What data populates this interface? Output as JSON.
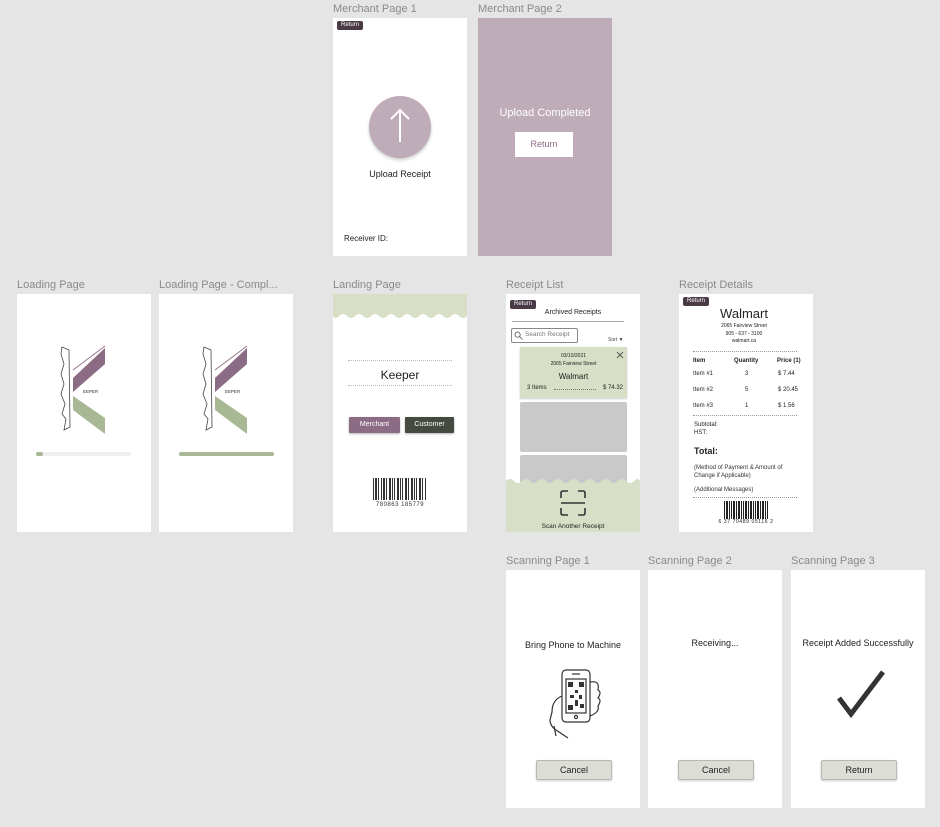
{
  "frames": {
    "merchant1": {
      "label": "Merchant Page 1",
      "return_label": "Return",
      "upload_label": "Upload Receipt",
      "receiver_label": "Receiver ID:"
    },
    "merchant2": {
      "label": "Merchant Page 2",
      "status": "Upload Completed",
      "return_label": "Return"
    },
    "loading": {
      "label": "Loading Page",
      "logo_text": "EEPER",
      "progress": 0.07
    },
    "loading_complete": {
      "label": "Loading Page - Compl...",
      "logo_text": "EEPER",
      "progress": 1.0
    },
    "landing": {
      "label": "Landing Page",
      "app_name": "Keeper",
      "merchant_label": "Merchant",
      "customer_label": "Customer",
      "barcode_number": "780863 185779"
    },
    "receipt_list": {
      "label": "Receipt List",
      "return_label": "Return",
      "title": "Archived Receipts",
      "search_placeholder": "Search Receipt",
      "sort_label": "Sort ▼",
      "card": {
        "date": "03/10/2021",
        "address": "2065 Fairview Street",
        "store": "Walmart",
        "items": "3 Items",
        "total": "$ 74.32"
      },
      "scan_label": "Scan Another Receipt"
    },
    "receipt_details": {
      "label": "Receipt Details",
      "return_label": "Return",
      "store": "Walmart",
      "address": "2065 Fairview Street",
      "phone": "905 - 637 - 3100",
      "website": "walmart.ca",
      "headers": [
        "Item",
        "Quantity",
        "Price (1)"
      ],
      "rows": [
        [
          "Item #1",
          "3",
          "$ 7.44"
        ],
        [
          "Item #2",
          "5",
          "$ 20.45"
        ],
        [
          "Item #3",
          "1",
          "$ 1.56"
        ]
      ],
      "subtotal_label": "Subtotal:",
      "hst_label": "HST:",
      "total_label": "Total:",
      "payment_note": "(Method of Payment & Amount of Change if Applicable)",
      "messages_note": "(Additional Messages)",
      "barcode_number": "6 37 70489 05116 2"
    },
    "scan1": {
      "label": "Scanning Page 1",
      "message": "Bring Phone to Machine",
      "cancel_label": "Cancel"
    },
    "scan2": {
      "label": "Scanning Page 2",
      "message": "Receiving...",
      "cancel_label": "Cancel"
    },
    "scan3": {
      "label": "Scanning Page 3",
      "message": "Receipt Added Successfully",
      "return_label": "Return"
    }
  },
  "colors": {
    "canvas": "#e5e5e5",
    "mauve": "#bfacb9",
    "mauve_dark": "#8c6b85",
    "sage": "#d7e0c6",
    "sage_dark": "#a9b894",
    "dark": "#4a3a45"
  }
}
